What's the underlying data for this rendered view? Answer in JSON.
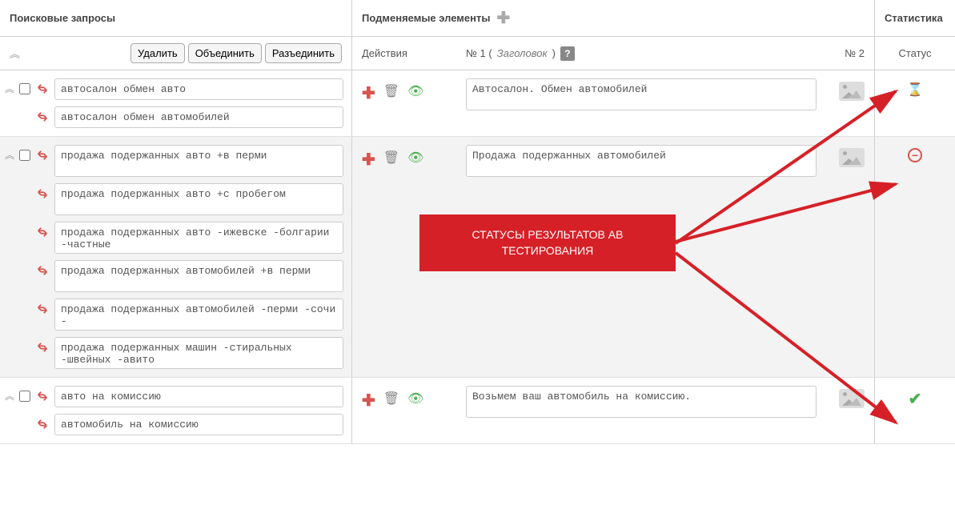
{
  "headers": {
    "left": "Поисковые запросы",
    "mid": "Подменяемые элементы",
    "right": "Статистика"
  },
  "subheaders": {
    "actions": "Действия",
    "col1_prefix": "№ 1 (",
    "col1_title": "Заголовок",
    "col1_suffix": " )",
    "help": "?",
    "col2": "№ 2",
    "status": "Статус"
  },
  "buttons": {
    "delete": "Удалить",
    "merge": "Объединить",
    "split": "Разъединить"
  },
  "callout": {
    "line1": "СТАТУСЫ РЕЗУЛЬТАТОВ АВ",
    "line2": "ТЕСТИРОВАНИЯ"
  },
  "groups": [
    {
      "alt": false,
      "queries": [
        {
          "type": "input",
          "text": "автосалон обмен авто"
        },
        {
          "type": "input",
          "text": "автосалон обмен автомобилей"
        }
      ],
      "replacement": "Автосалон. Обмен автомобилей",
      "status": "hourglass"
    },
    {
      "alt": true,
      "queries": [
        {
          "type": "textarea",
          "text": "продажа подержанных авто +в перми"
        },
        {
          "type": "textarea",
          "text": "продажа подержанных авто +с пробегом"
        },
        {
          "type": "textarea",
          "text": "продажа подержанных авто -ижевске -болгарии -частные"
        },
        {
          "type": "textarea",
          "text": "продажа подержанных автомобилей +в перми"
        },
        {
          "type": "textarea",
          "text": "продажа подержанных автомобилей -перми -сочи -"
        },
        {
          "type": "textarea",
          "text": "продажа подержанных машин -стиральных -швейных -авито"
        }
      ],
      "replacement": "Продажа подержанных автомобилей",
      "status": "minus"
    },
    {
      "alt": false,
      "queries": [
        {
          "type": "input",
          "text": "авто на комиссию"
        },
        {
          "type": "input",
          "text": "автомобиль на комиссию"
        }
      ],
      "replacement": "Возьмем ваш автомобиль на комиссию.",
      "status": "check"
    }
  ]
}
